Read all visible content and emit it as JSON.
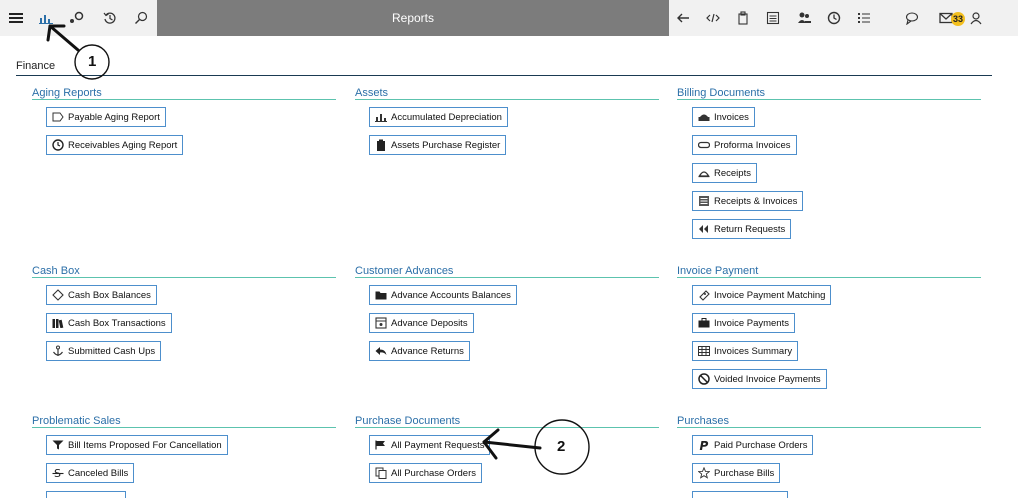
{
  "topbar": {
    "title": "Reports",
    "badge_count": "33",
    "left_icons": [
      "menu-icon",
      "bar-chart-icon",
      "settings-dots-icon",
      "history-icon",
      "search-icon"
    ],
    "right_icons": [
      "back-arrow-icon",
      "code-icon",
      "copy-icon",
      "list-box-icon",
      "users-icon",
      "clock-icon",
      "numbered-list-icon",
      "chat-icon",
      "mail-icon",
      "user-icon"
    ]
  },
  "section": {
    "title": "Finance"
  },
  "groups": [
    {
      "title": "Aging Reports",
      "items": [
        "Payable Aging Report",
        "Receivables Aging Report"
      ]
    },
    {
      "title": "Assets",
      "items": [
        "Accumulated Depreciation",
        "Assets Purchase Register"
      ]
    },
    {
      "title": "Billing Documents",
      "items": [
        "Invoices",
        "Proforma Invoices",
        "Receipts",
        "Receipts & Invoices",
        "Return Requests"
      ]
    },
    {
      "title": "Cash Box",
      "items": [
        "Cash Box Balances",
        "Cash Box Transactions",
        "Submitted Cash Ups"
      ]
    },
    {
      "title": "Customer Advances",
      "items": [
        "Advance Accounts Balances",
        "Advance Deposits",
        "Advance Returns"
      ]
    },
    {
      "title": "Invoice Payment",
      "items": [
        "Invoice Payment Matching",
        "Invoice Payments",
        "Invoices Summary",
        "Voided Invoice Payments"
      ]
    },
    {
      "title": "Problematic Sales",
      "items": [
        "Bill Items Proposed For Cancellation",
        "Canceled Bills"
      ]
    },
    {
      "title": "Purchase Documents",
      "items": [
        "All Payment Requests",
        "All Purchase Orders"
      ]
    },
    {
      "title": "Purchases",
      "items": [
        "Paid Purchase Orders",
        "Purchase Bills"
      ]
    }
  ],
  "annotations": {
    "label_1": "1",
    "label_2": "2"
  },
  "colors": {
    "accent_line": "#5cc3ae",
    "group_title": "#2b6fa8",
    "item_border": "#4d8fcc",
    "title_bar": "#7c7c7c",
    "badge": "#f3bf1e"
  }
}
